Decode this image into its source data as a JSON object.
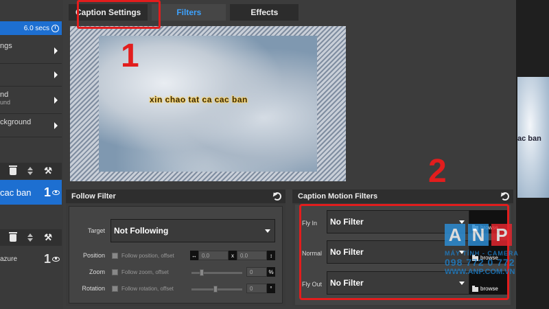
{
  "left": {
    "duration": "6.0 secs",
    "menu": [
      {
        "label": "ngs",
        "sub": ""
      },
      {
        "label": "",
        "sub": ""
      },
      {
        "label": "nd",
        "sub": "und"
      },
      {
        "label": "ckground",
        "sub": ""
      }
    ],
    "captions": [
      {
        "text": "cac ban",
        "num": "1",
        "selected": true
      },
      {
        "text": "azure",
        "num": "1",
        "selected": false
      }
    ]
  },
  "tabs": [
    {
      "label": "Caption Settings",
      "active": false
    },
    {
      "label": "Filters",
      "active": true
    },
    {
      "label": "Effects",
      "active": false
    }
  ],
  "preview": {
    "caption": "xin chao tat ca cac ban"
  },
  "annotations": {
    "one": "1",
    "two": "2"
  },
  "follow_filter": {
    "title": "Follow Filter",
    "target_label": "Target",
    "target_value": "Not Following",
    "rows": [
      {
        "label": "Position",
        "text": "Follow position, offset",
        "v1": "0.0",
        "sep": "x",
        "v2": "0.0"
      },
      {
        "label": "Zoom",
        "text": "Follow zoom, offset",
        "v": "0",
        "unit": "%"
      },
      {
        "label": "Rotation",
        "text": "Follow rotation, offset",
        "v": "0",
        "unit": "°"
      }
    ]
  },
  "motion_filters": {
    "title": "Caption Motion Filters",
    "rows": [
      {
        "label": "Fly In",
        "value": "No Filter",
        "browse": "browse"
      },
      {
        "label": "Normal",
        "value": "No Filter",
        "browse": "browse"
      },
      {
        "label": "Fly Out",
        "value": "No Filter",
        "browse": "browse"
      }
    ]
  },
  "watermark": {
    "letters": [
      "A",
      "N",
      "P"
    ],
    "sub": "MÁY TÍNH - CAMERA",
    "phone": "098 772 0 772",
    "web": "WWW.ANP.COM.VN"
  },
  "right": {
    "caption": "ac ban"
  },
  "colors": {
    "accent": "#1d6fd1",
    "tab_active": "#3ea3ff",
    "annotation": "#e21d1d"
  }
}
